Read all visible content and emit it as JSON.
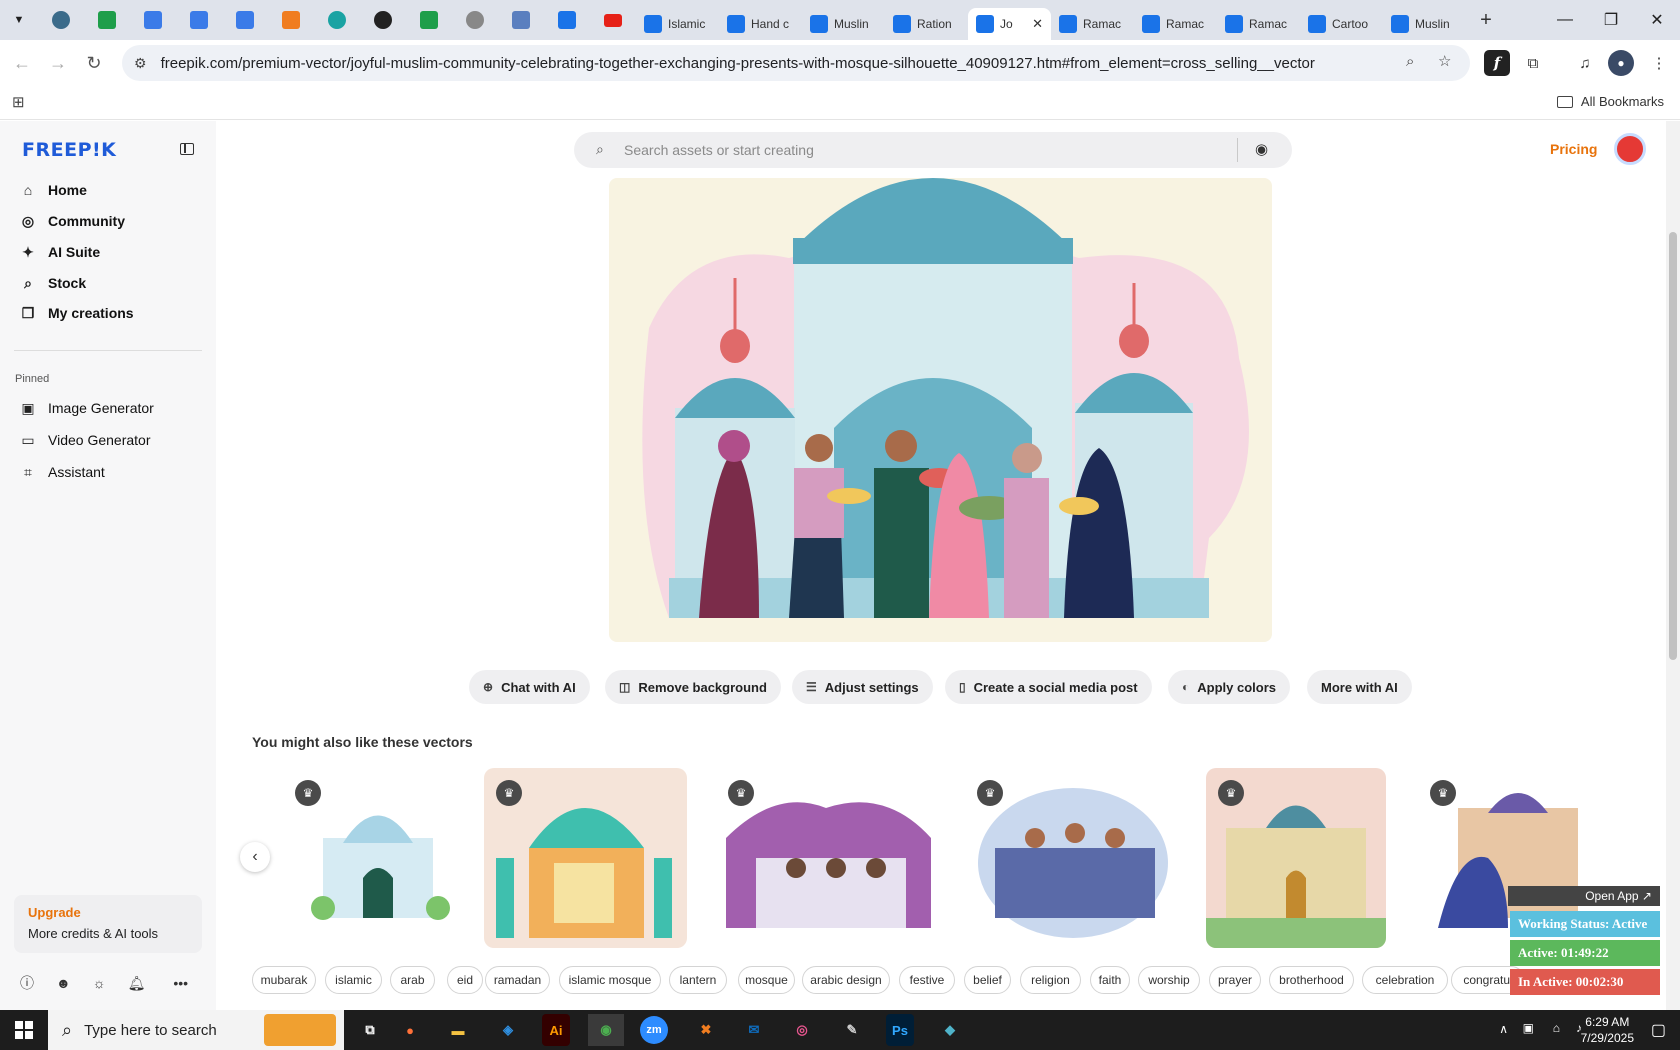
{
  "browser": {
    "tabs": [
      {
        "title": "Islamic",
        "color": "#1a73e8"
      },
      {
        "title": "Hand c",
        "color": "#1a73e8"
      },
      {
        "title": "Muslin",
        "color": "#1a73e8"
      },
      {
        "title": "Ration",
        "color": "#1a73e8"
      },
      {
        "title": "Jo",
        "color": "#1a73e8",
        "active": true
      },
      {
        "title": "Ramac",
        "color": "#1a73e8"
      },
      {
        "title": "Ramac",
        "color": "#1a73e8"
      },
      {
        "title": "Ramac",
        "color": "#1a73e8"
      },
      {
        "title": "Cartoo",
        "color": "#1a73e8"
      },
      {
        "title": "Muslin",
        "color": "#1a73e8"
      }
    ],
    "url": "freepik.com/premium-vector/joyful-muslim-community-celebrating-together-exchanging-presents-with-mosque-silhouette_40909127.htm#from_element=cross_selling__vector",
    "all_bookmarks": "All Bookmarks"
  },
  "sidebar": {
    "logo": "FREEP!K",
    "nav": [
      {
        "label": "Home",
        "icon": "home-icon",
        "glyph": "⌂"
      },
      {
        "label": "Community",
        "icon": "globe-icon",
        "glyph": "◎"
      },
      {
        "label": "AI Suite",
        "icon": "sparkle-icon",
        "glyph": "✦"
      },
      {
        "label": "Stock",
        "icon": "search-icon",
        "glyph": "⌕"
      },
      {
        "label": "My creations",
        "icon": "stack-icon",
        "glyph": "❐"
      }
    ],
    "pinned_label": "Pinned",
    "pinned": [
      {
        "label": "Image Generator",
        "icon": "image-icon",
        "glyph": "▣"
      },
      {
        "label": "Video Generator",
        "icon": "video-icon",
        "glyph": "▭"
      },
      {
        "label": "Assistant",
        "icon": "chat-icon",
        "glyph": "⌗"
      }
    ],
    "upgrade": {
      "title": "Upgrade",
      "subtitle": "More credits & AI tools"
    }
  },
  "search": {
    "placeholder": "Search assets or start creating"
  },
  "header": {
    "pricing": "Pricing"
  },
  "ai_actions": [
    {
      "label": "Chat with AI",
      "icon": "chat-plus-icon",
      "glyph": "⊕"
    },
    {
      "label": "Remove background",
      "icon": "remove-bg-icon",
      "glyph": "◫"
    },
    {
      "label": "Adjust settings",
      "icon": "sliders-icon",
      "glyph": "☰"
    },
    {
      "label": "Create a social media post",
      "icon": "phone-icon",
      "glyph": "▯"
    },
    {
      "label": "Apply colors",
      "icon": "palette-icon",
      "glyph": "◐"
    },
    {
      "label": "More with AI",
      "icon": "",
      "glyph": ""
    }
  ],
  "related": {
    "title": "You might also like these vectors"
  },
  "tags": [
    "mubarak",
    "islamic",
    "arab",
    "eid",
    "ramadan",
    "islamic mosque",
    "lantern",
    "mosque",
    "arabic design",
    "festive",
    "belief",
    "religion",
    "faith",
    "worship",
    "prayer",
    "brotherhood",
    "celebration",
    "congratul"
  ],
  "overlay": {
    "open_app": "Open App ↗",
    "working_status": "Working Status: Active",
    "active": "Active: 01:49:22",
    "inactive": "In Active: 00:02:30",
    "colors": {
      "status": "#5bc0de",
      "active": "#5cb85c",
      "inactive": "#e05a4f"
    }
  },
  "taskbar": {
    "search_placeholder": "Type here to search",
    "time": "6:29 AM",
    "date": "7/29/2025"
  },
  "colors": {
    "accent": "#1f5bd8",
    "orange": "#e8730c"
  }
}
